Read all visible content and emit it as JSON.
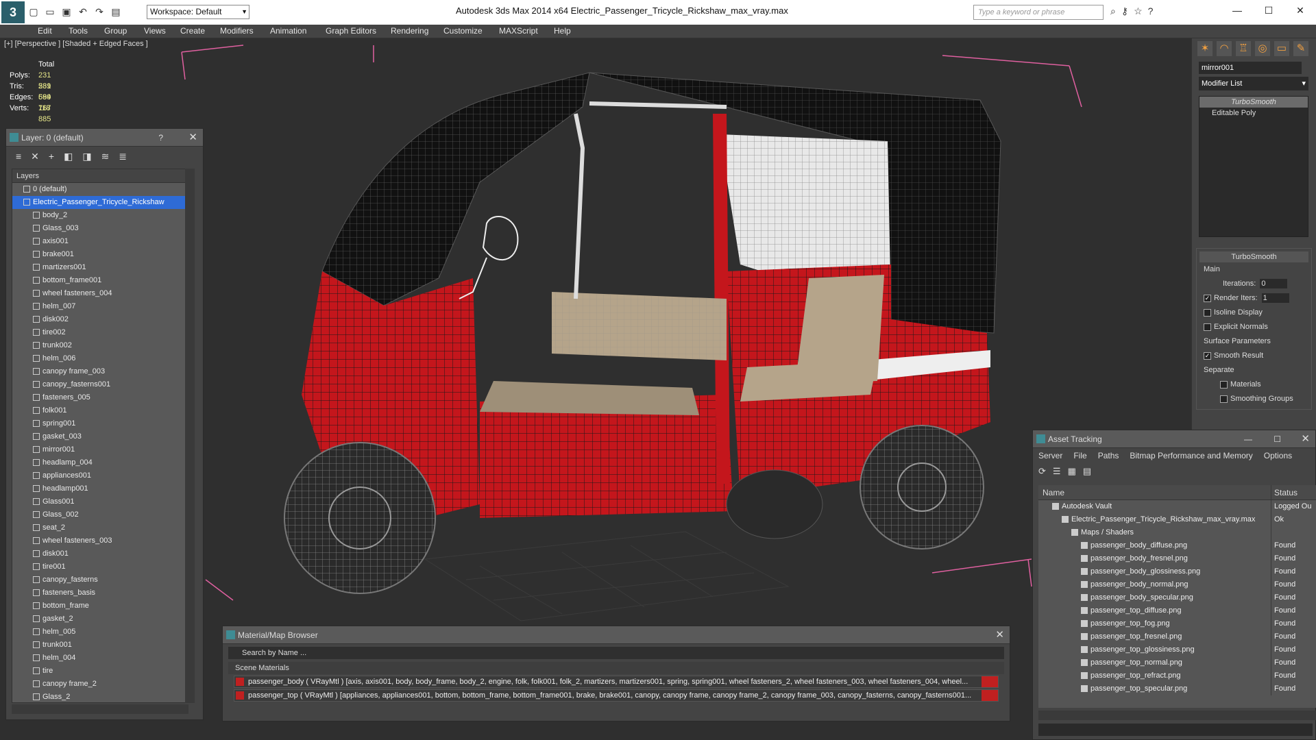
{
  "app": {
    "logo": "3",
    "window_title": "Autodesk 3ds Max  2014 x64      Electric_Passenger_Tricycle_Rickshaw_max_vray.max",
    "workspace": "Workspace: Default",
    "search_placeholder": "Type a keyword or phrase"
  },
  "menu": [
    "Edit",
    "Tools",
    "Group",
    "Views",
    "Create",
    "Modifiers",
    "Animation",
    "Graph Editors",
    "Rendering",
    "Customize",
    "MAXScript",
    "Help"
  ],
  "viewport": {
    "label": "[+] [Perspective ] [Shaded + Edged Faces ]",
    "stats_header": "Total",
    "stats": [
      {
        "k": "Polys:",
        "v": "231 589"
      },
      {
        "k": "Tris:",
        "v": "231 589"
      },
      {
        "k": "Edges:",
        "v": "694 767"
      },
      {
        "k": "Verts:",
        "v": "118 885"
      }
    ]
  },
  "layer_panel": {
    "title": "Layer: 0 (default)",
    "help": "?",
    "list_header": "Layers",
    "layers": [
      "0 (default)",
      "Electric_Passenger_Tricycle_Rickshaw",
      "body_2",
      "Glass_003",
      "axis001",
      "brake001",
      "martizers001",
      "bottom_frame001",
      "wheel fasteners_004",
      "helm_007",
      "disk002",
      "tire002",
      "trunk002",
      "helm_006",
      "canopy frame_003",
      "canopy_fasterns001",
      "fasteners_005",
      "folk001",
      "spring001",
      "gasket_003",
      "mirror001",
      "headlamp_004",
      "appliances001",
      "headlamp001",
      "Glass001",
      "Glass_002",
      "seat_2",
      "wheel fasteners_003",
      "disk001",
      "tire001",
      "canopy_fasterns",
      "fasteners_basis",
      "bottom_frame",
      "gasket_2",
      "helm_005",
      "trunk001",
      "helm_004",
      "tire",
      "canopy frame_2",
      "Glass_2"
    ],
    "selected_index": 1
  },
  "command_panel": {
    "object_name": "mirror001",
    "modifier_list": "Modifier List",
    "stack": [
      "TurboSmooth",
      "Editable Poly"
    ],
    "rollout": {
      "title": "TurboSmooth",
      "main": "Main",
      "iterations_label": "Iterations:",
      "iterations": "0",
      "render_iters_label": "Render Iters:",
      "render_iters": "1",
      "isoline": "Isoline Display",
      "explicit": "Explicit Normals",
      "surface": "Surface Parameters",
      "smooth_result": "Smooth Result",
      "separate": "Separate",
      "materials": "Materials",
      "smoothing_groups": "Smoothing Groups"
    }
  },
  "asset_panel": {
    "title": "Asset Tracking",
    "menu": [
      "Server",
      "File",
      "Paths",
      "Bitmap Performance and Memory",
      "Options"
    ],
    "col_name": "Name",
    "col_status": "Status",
    "rows": [
      {
        "name": "Autodesk Vault",
        "status": "Logged Ou",
        "indent": 1
      },
      {
        "name": "Electric_Passenger_Tricycle_Rickshaw_max_vray.max",
        "status": "Ok",
        "indent": 2
      },
      {
        "name": "Maps / Shaders",
        "status": "",
        "indent": 3
      },
      {
        "name": "passenger_body_diffuse.png",
        "status": "Found",
        "indent": 4
      },
      {
        "name": "passenger_body_fresnel.png",
        "status": "Found",
        "indent": 4
      },
      {
        "name": "passenger_body_glossiness.png",
        "status": "Found",
        "indent": 4
      },
      {
        "name": "passenger_body_normal.png",
        "status": "Found",
        "indent": 4
      },
      {
        "name": "passenger_body_specular.png",
        "status": "Found",
        "indent": 4
      },
      {
        "name": "passenger_top_diffuse.png",
        "status": "Found",
        "indent": 4
      },
      {
        "name": "passenger_top_fog.png",
        "status": "Found",
        "indent": 4
      },
      {
        "name": "passenger_top_fresnel.png",
        "status": "Found",
        "indent": 4
      },
      {
        "name": "passenger_top_glossiness.png",
        "status": "Found",
        "indent": 4
      },
      {
        "name": "passenger_top_normal.png",
        "status": "Found",
        "indent": 4
      },
      {
        "name": "passenger_top_refract.png",
        "status": "Found",
        "indent": 4
      },
      {
        "name": "passenger_top_specular.png",
        "status": "Found",
        "indent": 4
      }
    ]
  },
  "mat_panel": {
    "title": "Material/Map Browser",
    "search": "Search by Name ...",
    "group": "Scene Materials",
    "rows": [
      "passenger_body  ( VRayMtl ) [axis, axis001, body, body_frame, body_2, engine, folk, folk001, folk_2, martizers, martizers001, spring, spring001, wheel fasteners_2, wheel fasteners_003, wheel fasteners_004, wheel...",
      "passenger_top  ( VRayMtl ) [appliances, appliances001, bottom, bottom_frame, bottom_frame001, brake, brake001, canopy, canopy frame, canopy frame_2, canopy frame_003, canopy_fasterns, canopy_fasterns001..."
    ]
  },
  "colors": {
    "body_red": "#c4161c",
    "wire": "#1a1a1a",
    "selection": "#2e6bd6",
    "viewport_bg": "#2f2f2f"
  }
}
